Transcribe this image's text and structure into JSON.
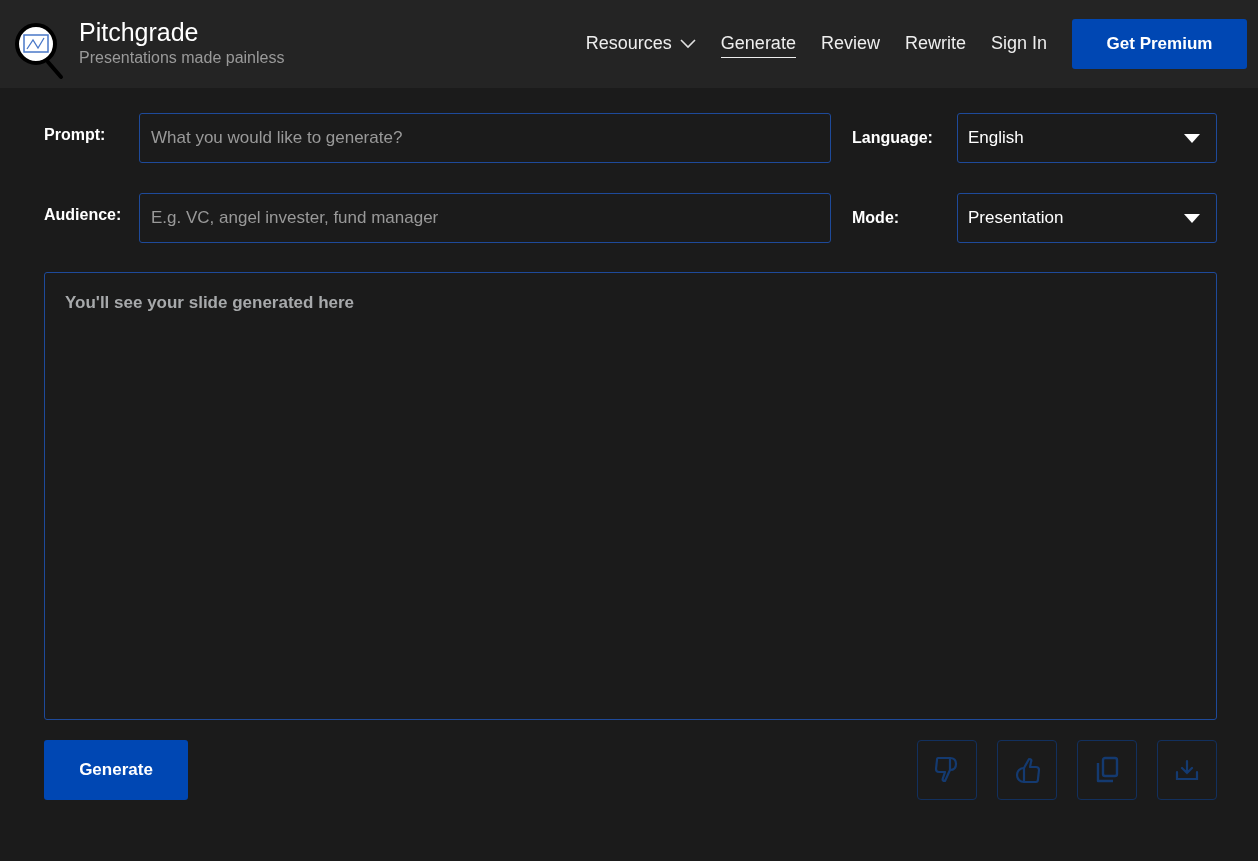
{
  "brand": {
    "name": "Pitchgrade",
    "tagline": "Presentations made painless"
  },
  "nav": [
    {
      "label": "Resources",
      "kind": "dropdown",
      "selected": false
    },
    {
      "label": "Generate",
      "kind": "link",
      "selected": true
    },
    {
      "label": "Review",
      "kind": "link",
      "selected": false
    },
    {
      "label": "Rewrite",
      "kind": "link",
      "selected": false
    },
    {
      "label": "Sign In",
      "kind": "link",
      "selected": false
    }
  ],
  "premium_button": "Get Premium",
  "form": [
    {
      "label": "Prompt:",
      "placeholder": "What you would like to generate?",
      "select_label": "Language:",
      "select_value": "English"
    },
    {
      "label": "Audience:",
      "placeholder": "E.g. VC, angel invester, fund manager",
      "select_label": "Mode:",
      "select_value": "Presentation"
    }
  ],
  "output": {
    "placeholder": "You'll see your slide generated here"
  },
  "generate_button": "Generate",
  "actions": [
    {
      "kind": "dislike",
      "disabled": true
    },
    {
      "kind": "like",
      "disabled": true
    },
    {
      "kind": "copy",
      "disabled": true
    },
    {
      "kind": "download",
      "disabled": true
    }
  ]
}
